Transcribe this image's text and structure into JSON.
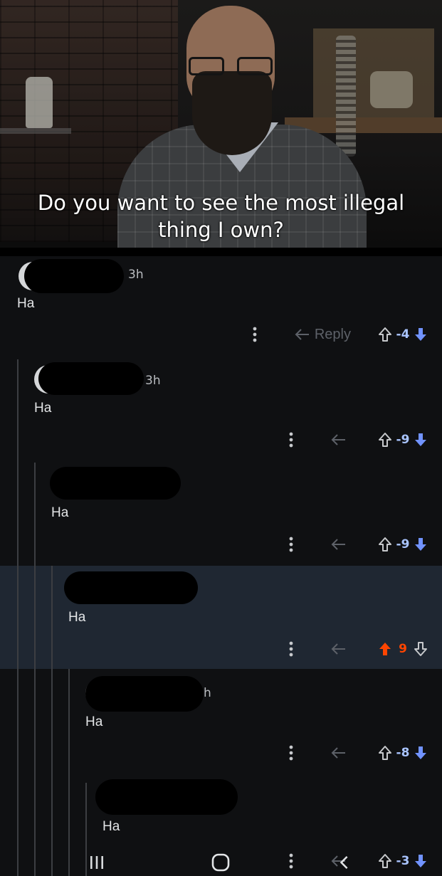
{
  "meme": {
    "caption_line1": "Do you want to see the most illegal",
    "caption_line2": "thing I own?"
  },
  "comments": [
    {
      "time": "3h",
      "body": "Ha",
      "reply_label": "Reply",
      "score": "-4",
      "vote": "none"
    },
    {
      "time": "3h",
      "body": "Ha",
      "reply_label": "",
      "score": "-9",
      "vote": "none"
    },
    {
      "time": "",
      "body": "Ha",
      "reply_label": "",
      "score": "-9",
      "vote": "none"
    },
    {
      "time": "",
      "body": "Ha",
      "reply_label": "",
      "score": "9",
      "vote": "up"
    },
    {
      "time": "h",
      "body": "Ha",
      "reply_label": "",
      "score": "-8",
      "vote": "none"
    },
    {
      "time": "",
      "body": "Ha",
      "reply_label": "",
      "score": "-3",
      "vote": "none"
    }
  ],
  "colors": {
    "upvote": "#ff4500",
    "downvote": "#7193ff",
    "score_neutral": "#a9c4ff",
    "highlight_bg": "#1f2732",
    "background": "#0f1012",
    "thread_line": "#3c3e42"
  },
  "icons": {
    "more": "vertical-ellipsis",
    "reply": "reply-arrow",
    "upvote": "arrow-up",
    "downvote": "arrow-down",
    "nav_recent": "three-bars",
    "nav_home": "rounded-square",
    "nav_back": "chevron-left"
  }
}
